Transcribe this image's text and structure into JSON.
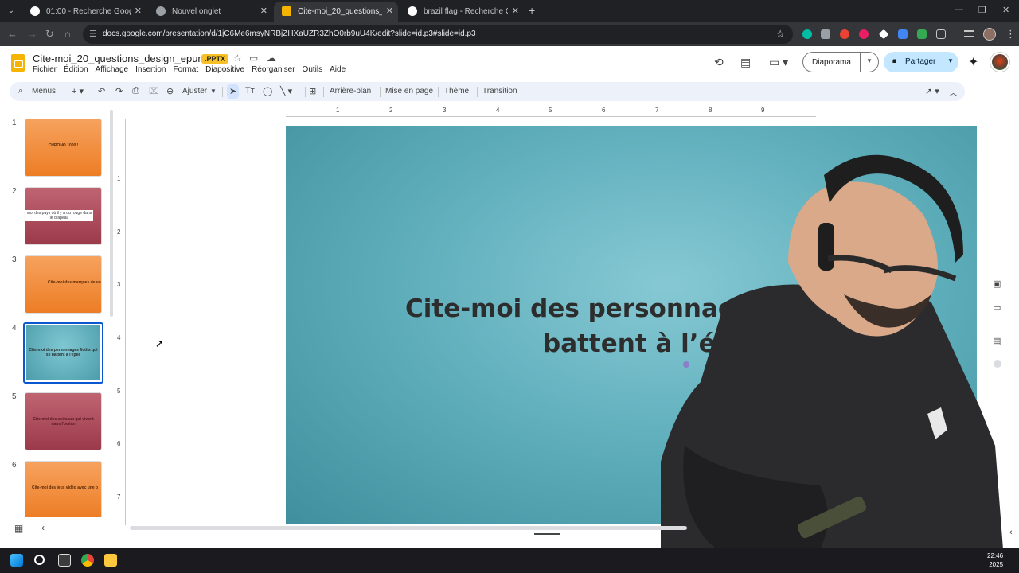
{
  "browser": {
    "tabs": [
      {
        "title": "01:00 - Recherche Google",
        "favicon_color": "#ffffff"
      },
      {
        "title": "Nouvel onglet",
        "favicon_color": "#9aa0a6"
      },
      {
        "title": "Cite-moi_20_questions_design_",
        "favicon_color": "#f4b400"
      },
      {
        "title": "brazil flag - Recherche Google",
        "favicon_color": "#ffffff"
      }
    ],
    "url": "docs.google.com/presentation/d/1jC6Me6msyNRBjZHXaUZR3ZhO0rb9uU4K/edit?slide=id.p3#slide=id.p3"
  },
  "doc": {
    "title": "Cite-moi_20_questions_design_epure",
    "badge": ".PPTX",
    "menu": [
      "Fichier",
      "Édition",
      "Affichage",
      "Insertion",
      "Format",
      "Diapositive",
      "Réorganiser",
      "Outils",
      "Aide"
    ],
    "diaporama_label": "Diaporama",
    "share_label": "Partager"
  },
  "toolbar": {
    "menus_label": "Menus",
    "zoom_label": "Ajuster",
    "background_label": "Arrière-plan",
    "layout_label": "Mise en page",
    "theme_label": "Thème",
    "transition_label": "Transition"
  },
  "slides": [
    {
      "num": "1",
      "text": "CHRONO 1000 !",
      "style": "orange"
    },
    {
      "num": "2",
      "text": "moi des pays où il y a du rouge dans le drapeau",
      "style": "red"
    },
    {
      "num": "3",
      "text": "Cite-moi des marques de voiture",
      "style": "orange"
    },
    {
      "num": "4",
      "text": "Cite-moi des personnages fictifs qui se battent à l'épée",
      "style": "teal"
    },
    {
      "num": "5",
      "text": "Cite-moi des animaux qui vivent dans l'océan",
      "style": "red"
    },
    {
      "num": "6",
      "text": "Cite-moi des jeux vidéo avec une b",
      "style": "orange"
    }
  ],
  "current_slide": {
    "line1": "Cite-moi des personnages ficti",
    "line2": "battent à l’épé"
  },
  "ruler": {
    "h": [
      "1",
      "2",
      "3",
      "4",
      "5",
      "6",
      "7",
      "8",
      "9"
    ],
    "v": [
      "1",
      "2",
      "3",
      "4",
      "5",
      "6",
      "7"
    ]
  },
  "taskbar": {
    "time": "22:46",
    "date": "2025"
  }
}
